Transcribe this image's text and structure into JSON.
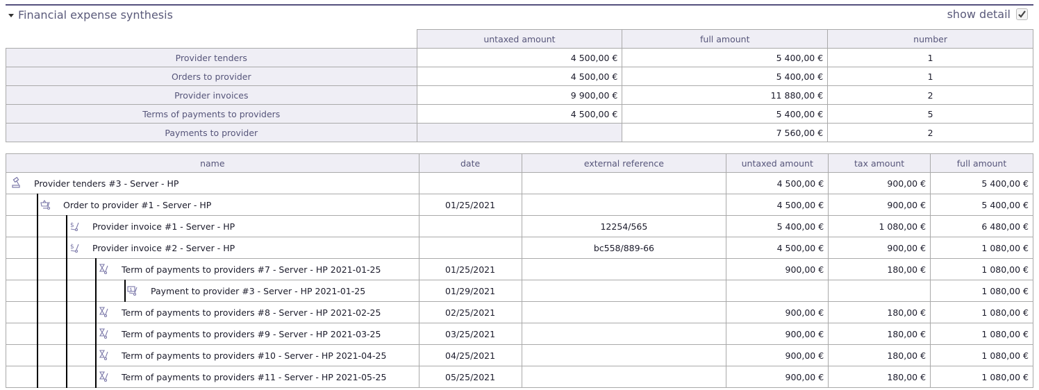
{
  "header": {
    "title": "Financial expense synthesis",
    "show_detail_label": "show detail",
    "show_detail_checked": true
  },
  "summary": {
    "columns": [
      "untaxed amount",
      "full amount",
      "number"
    ],
    "rows": [
      {
        "label": "Provider tenders",
        "untaxed": "4 500,00 €",
        "full": "5 400,00 €",
        "number": "1"
      },
      {
        "label": "Orders to provider",
        "untaxed": "4 500,00 €",
        "full": "5 400,00 €",
        "number": "1"
      },
      {
        "label": "Provider invoices",
        "untaxed": "9 900,00 €",
        "full": "11 880,00 €",
        "number": "2"
      },
      {
        "label": "Terms of payments to providers",
        "untaxed": "4 500,00 €",
        "full": "5 400,00 €",
        "number": "5"
      },
      {
        "label": "Payments to provider",
        "untaxed": "",
        "full": "7 560,00 €",
        "number": "2"
      }
    ]
  },
  "detail": {
    "columns": [
      "name",
      "date",
      "external reference",
      "untaxed amount",
      "tax amount",
      "full amount"
    ],
    "rows": [
      {
        "level": 0,
        "icon": "gavel-icon",
        "name": "Provider tenders #3 - Server - HP",
        "date": "",
        "ref": "",
        "untaxed": "4 500,00 €",
        "tax": "900,00 €",
        "full": "5 400,00 €"
      },
      {
        "level": 1,
        "icon": "basket-icon",
        "name": "Order to provider #1 - Server - HP",
        "date": "01/25/2021",
        "ref": "",
        "untaxed": "4 500,00 €",
        "tax": "900,00 €",
        "full": "5 400,00 €"
      },
      {
        "level": 2,
        "icon": "invoice-dollar-icon",
        "name": "Provider invoice #1 - Server - HP",
        "date": "",
        "ref": "12254/565",
        "untaxed": "5 400,00 €",
        "tax": "1 080,00 €",
        "full": "6 480,00 €"
      },
      {
        "level": 2,
        "icon": "invoice-dollar-icon",
        "name": "Provider invoice #2 - Server - HP",
        "date": "",
        "ref": "bc558/889-66",
        "untaxed": "4 500,00 €",
        "tax": "900,00 €",
        "full": "1 080,00 €"
      },
      {
        "level": 3,
        "icon": "hourglass-icon",
        "name": "Term of payments to providers #7 - Server - HP 2021-01-25",
        "date": "01/25/2021",
        "ref": "",
        "untaxed": "900,00 €",
        "tax": "180,00 €",
        "full": "1 080,00 €"
      },
      {
        "level": 4,
        "icon": "payment-icon",
        "name": "Payment to provider #3 - Server - HP 2021-01-25",
        "date": "01/29/2021",
        "ref": "",
        "untaxed": "",
        "tax": "",
        "full": "1 080,00 €"
      },
      {
        "level": 3,
        "icon": "hourglass-icon",
        "name": "Term of payments to providers #8 - Server - HP 2021-02-25",
        "date": "02/25/2021",
        "ref": "",
        "untaxed": "900,00 €",
        "tax": "180,00 €",
        "full": "1 080,00 €"
      },
      {
        "level": 3,
        "icon": "hourglass-icon",
        "name": "Term of payments to providers #9 - Server - HP 2021-03-25",
        "date": "03/25/2021",
        "ref": "",
        "untaxed": "900,00 €",
        "tax": "180,00 €",
        "full": "1 080,00 €"
      },
      {
        "level": 3,
        "icon": "hourglass-icon",
        "name": "Term of payments to providers #10 - Server - HP 2021-04-25",
        "date": "04/25/2021",
        "ref": "",
        "untaxed": "900,00 €",
        "tax": "180,00 €",
        "full": "1 080,00 €"
      },
      {
        "level": 3,
        "icon": "hourglass-icon",
        "name": "Term of payments to providers #11 - Server - HP 2021-05-25",
        "date": "05/25/2021",
        "ref": "",
        "untaxed": "900,00 €",
        "tax": "180,00 €",
        "full": "1 080,00 €"
      }
    ]
  },
  "colors": {
    "accent_line": "#54507d",
    "header_bg": "#efeef5",
    "header_text": "#56557a",
    "icon": "#7a77a8"
  }
}
